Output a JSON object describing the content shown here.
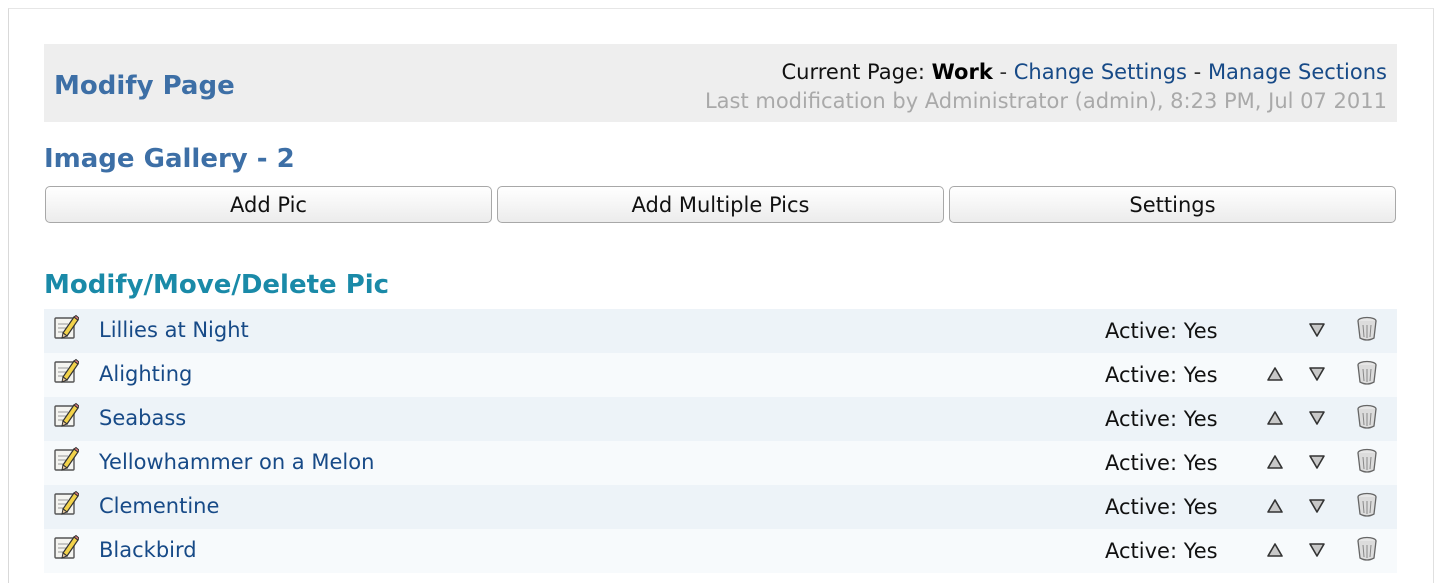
{
  "header": {
    "title": "Modify Page",
    "current_page_label": "Current Page:",
    "current_page": "Work",
    "sep1": "-",
    "change_settings": "Change Settings",
    "sep2": "-",
    "manage_sections": "Manage Sections",
    "last_modification": "Last modification by Administrator (admin), 8:23 PM, Jul 07 2011"
  },
  "gallery": {
    "title": "Image Gallery - 2",
    "buttons": {
      "add_pic": "Add Pic",
      "add_multiple": "Add Multiple Pics",
      "settings": "Settings"
    }
  },
  "section_title": "Modify/Move/Delete Pic",
  "pics": [
    {
      "name": "Lillies at Night",
      "status": "Active: Yes"
    },
    {
      "name": "Alighting",
      "status": "Active: Yes"
    },
    {
      "name": "Seabass",
      "status": "Active: Yes"
    },
    {
      "name": "Yellowhammer on a Melon",
      "status": "Active: Yes"
    },
    {
      "name": "Clementine",
      "status": "Active: Yes"
    },
    {
      "name": "Blackbird",
      "status": "Active: Yes"
    }
  ],
  "icons": {
    "edit": "edit-icon",
    "move_up": "move-up-icon",
    "move_down": "move-down-icon",
    "delete": "delete-icon"
  },
  "colors": {
    "heading": "#3d6fa6",
    "section_heading": "#1a8aa8",
    "link": "#174a87"
  }
}
